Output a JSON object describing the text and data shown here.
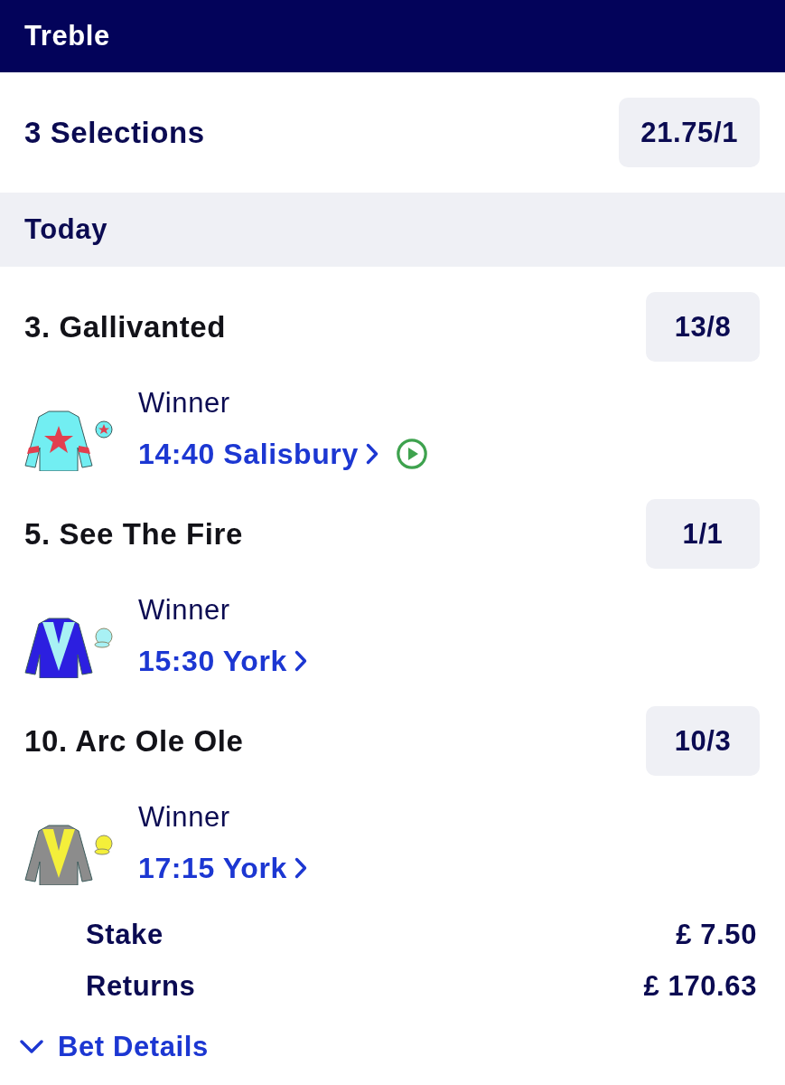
{
  "header": {
    "title": "Treble"
  },
  "summary": {
    "label": "3 Selections",
    "odds": "21.75/1"
  },
  "section": {
    "title": "Today"
  },
  "selections": [
    {
      "name": "3. Gallivanted",
      "odds": "13/8",
      "market": "Winner",
      "race": "14:40 Salisbury",
      "live_stream": true,
      "silk": {
        "kind": "star",
        "color": "#72eef2",
        "pattern": {
          "color": "#e23f4e"
        }
      }
    },
    {
      "name": "5. See The Fire",
      "odds": "1/1",
      "market": "Winner",
      "race": "15:30 York",
      "live_stream": false,
      "silk": {
        "kind": "chevron",
        "color": "#2c1fe0",
        "pattern": {
          "color": "#a8f1f4"
        }
      }
    },
    {
      "name": "10. Arc Ole Ole",
      "odds": "10/3",
      "market": "Winner",
      "race": "17:15 York",
      "live_stream": false,
      "silk": {
        "kind": "chevron",
        "color": "#8c8c8c",
        "pattern": {
          "color": "#f4ef3a"
        }
      }
    }
  ],
  "totals": [
    {
      "label": "Stake",
      "value": "£ 7.50"
    },
    {
      "label": "Returns",
      "value": "£ 170.63"
    }
  ],
  "bet_details": {
    "label": "Bet Details",
    "expanded": false
  }
}
